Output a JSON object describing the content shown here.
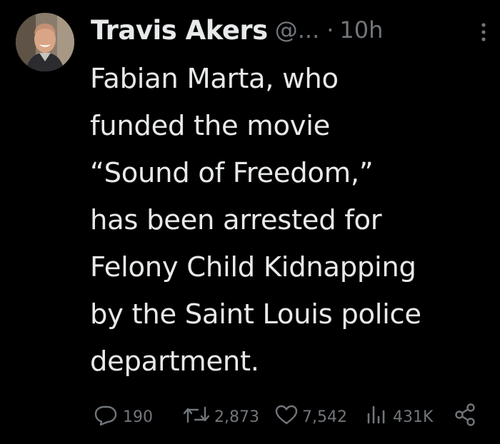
{
  "author": {
    "display_name": "Travis Akers",
    "handle": "@...",
    "separator": "·",
    "time": "10h",
    "avatar_icon": "profile-photo"
  },
  "tweet": {
    "text": "Fabian Marta, who\nfunded the movie\n“Sound of Freedom,”\nhas been arrested for\nFelony Child Kidnapping\nby the Saint Louis police\ndepartment."
  },
  "actions": {
    "replies": "190",
    "retweets": "2,873",
    "likes": "7,542",
    "views": "431K"
  },
  "icons": {
    "reply": "reply-icon",
    "retweet": "retweet-icon",
    "like": "heart-icon",
    "views": "views-icon",
    "share": "share-icon",
    "more": "more-icon"
  },
  "colors": {
    "background": "#000000",
    "text_primary": "#e7e9ea",
    "text_secondary": "#71767b"
  }
}
